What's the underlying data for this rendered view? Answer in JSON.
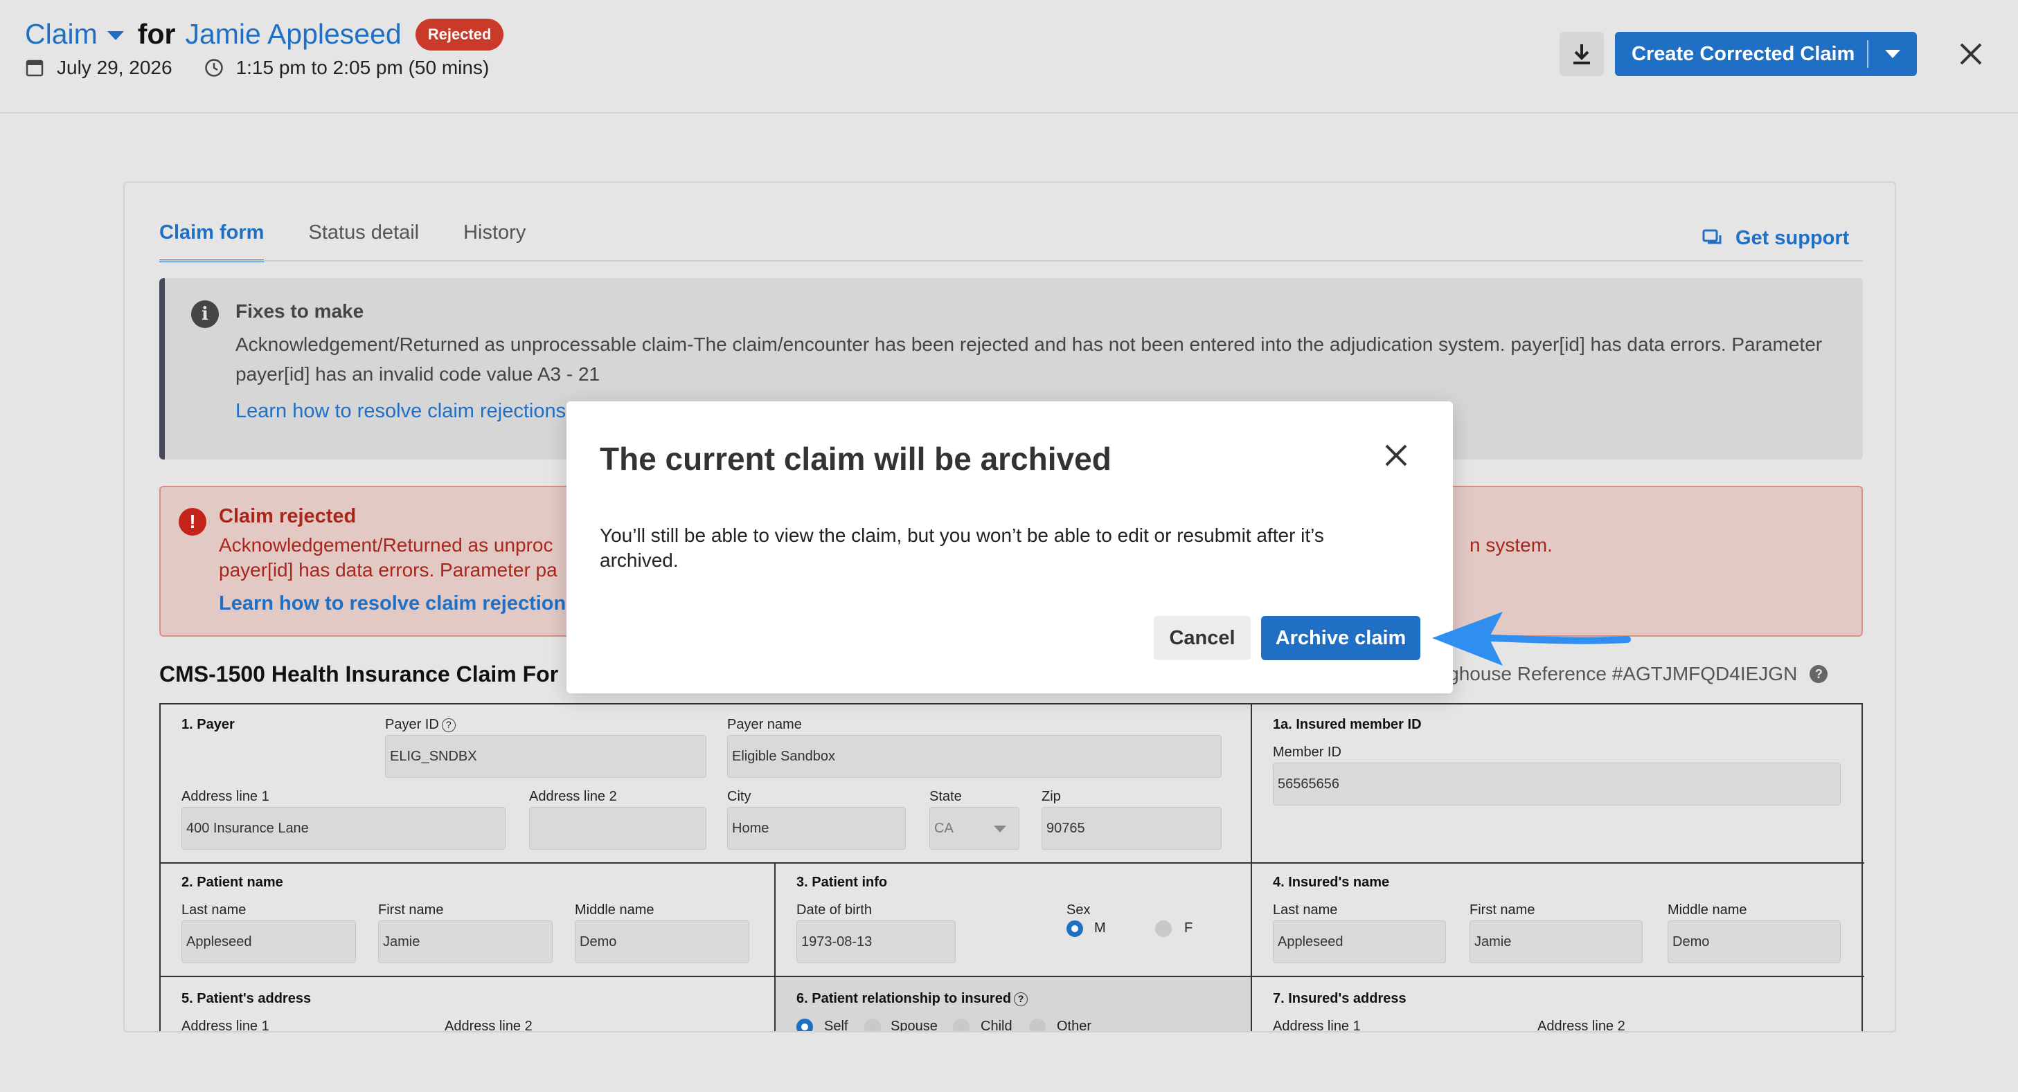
{
  "header": {
    "claim_label": "Claim",
    "for_label": "for",
    "patient_name": "Jamie Appleseed",
    "status_badge": "Rejected",
    "date": "July 29, 2026",
    "time_range": "1:15 pm to 2:05 pm (50 mins)",
    "primary_action": "Create Corrected Claim",
    "icons": [
      "calendar-icon",
      "clock-icon",
      "download-icon",
      "chevron-down-icon",
      "close-icon"
    ]
  },
  "tabs": [
    {
      "label": "Claim form",
      "active": true
    },
    {
      "label": "Status detail",
      "active": false
    },
    {
      "label": "History",
      "active": false
    }
  ],
  "support_label": "Get support",
  "fixes": {
    "title": "Fixes to make",
    "text": "Acknowledgement/Returned as unprocessable claim-The claim/encounter has been rejected and has not been entered into the adjudication system. payer[id] has data errors. Parameter payer[id] has an invalid code value A3 - 21",
    "link": "Learn how to resolve claim rejections"
  },
  "rejection": {
    "title": "Claim rejected",
    "line1": "Acknowledgement/Returned as unproc",
    "line2": "payer[id] has data errors. Parameter pa",
    "tail": "n system.",
    "link": "Learn how to resolve claim rejections"
  },
  "form": {
    "title": "CMS-1500 Health Insurance Claim For",
    "reference": "ringhouse Reference #AGTJMFQD4IEJGN",
    "payer": {
      "section": "1. Payer",
      "payer_id_label": "Payer ID",
      "payer_id": "ELIG_SNDBX",
      "payer_name_label": "Payer name",
      "payer_name": "Eligible Sandbox",
      "address1_label": "Address line 1",
      "address1": "400 Insurance Lane",
      "address2_label": "Address line 2",
      "address2": "",
      "city_label": "City",
      "city": "Home",
      "state_label": "State",
      "state": "CA",
      "zip_label": "Zip",
      "zip": "90765"
    },
    "insured_member": {
      "section": "1a. Insured member ID",
      "member_id_label": "Member ID",
      "member_id": "56565656"
    },
    "patient_name": {
      "section": "2. Patient name",
      "last_label": "Last name",
      "last": "Appleseed",
      "first_label": "First name",
      "first": "Jamie",
      "middle_label": "Middle name",
      "middle": "Demo"
    },
    "patient_info": {
      "section": "3. Patient info",
      "dob_label": "Date of birth",
      "dob": "1973-08-13",
      "sex_label": "Sex",
      "sex_m": "M",
      "sex_f": "F",
      "sex_selected": "M"
    },
    "insured_name": {
      "section": "4. Insured's name",
      "last_label": "Last name",
      "last": "Appleseed",
      "first_label": "First name",
      "first": "Jamie",
      "middle_label": "Middle name",
      "middle": "Demo"
    },
    "patient_address": {
      "section": "5. Patient's address",
      "address1_label": "Address line 1",
      "address2_label": "Address line 2"
    },
    "relationship": {
      "section": "6. Patient relationship to insured",
      "options": [
        "Self",
        "Spouse",
        "Child",
        "Other"
      ],
      "selected": "Self"
    },
    "insured_address": {
      "section": "7. Insured's address",
      "address1_label": "Address line 1",
      "address2_label": "Address line 2"
    }
  },
  "modal": {
    "title": "The current claim will be archived",
    "body": "You’ll still be able to view the claim, but you won’t be able to edit or resubmit after it’s archived.",
    "cancel": "Cancel",
    "confirm": "Archive claim"
  },
  "colors": {
    "accent": "#1f6fc4",
    "rejected": "#c93a28",
    "annotation_arrow": "#2f8ef0"
  }
}
